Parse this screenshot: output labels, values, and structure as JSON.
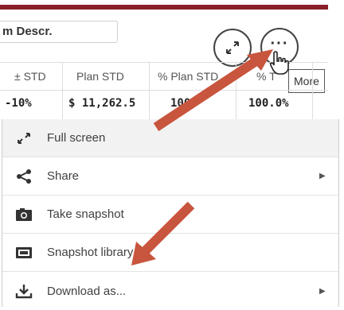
{
  "field_label": "m Descr.",
  "table": {
    "headers": [
      "± STD",
      "Plan STD",
      "% Plan STD",
      "% T"
    ],
    "values": [
      "-10%",
      "$ 11,262.5",
      "100%",
      "100.0%"
    ]
  },
  "tooltip": "More",
  "more_button_glyph": "···",
  "menu": {
    "items": [
      {
        "label": "Full screen",
        "icon": "expand-icon",
        "submenu": false
      },
      {
        "label": "Share",
        "icon": "share-icon",
        "submenu": true
      },
      {
        "label": "Take snapshot",
        "icon": "camera-icon",
        "submenu": false
      },
      {
        "label": "Snapshot library",
        "icon": "snapshot-library-icon",
        "submenu": false
      },
      {
        "label": "Download as...",
        "icon": "download-icon",
        "submenu": true
      }
    ],
    "submenu_arrow": "▶"
  },
  "colors": {
    "accent": "#8b1e2b",
    "annotation_arrow": "#c8553d"
  }
}
